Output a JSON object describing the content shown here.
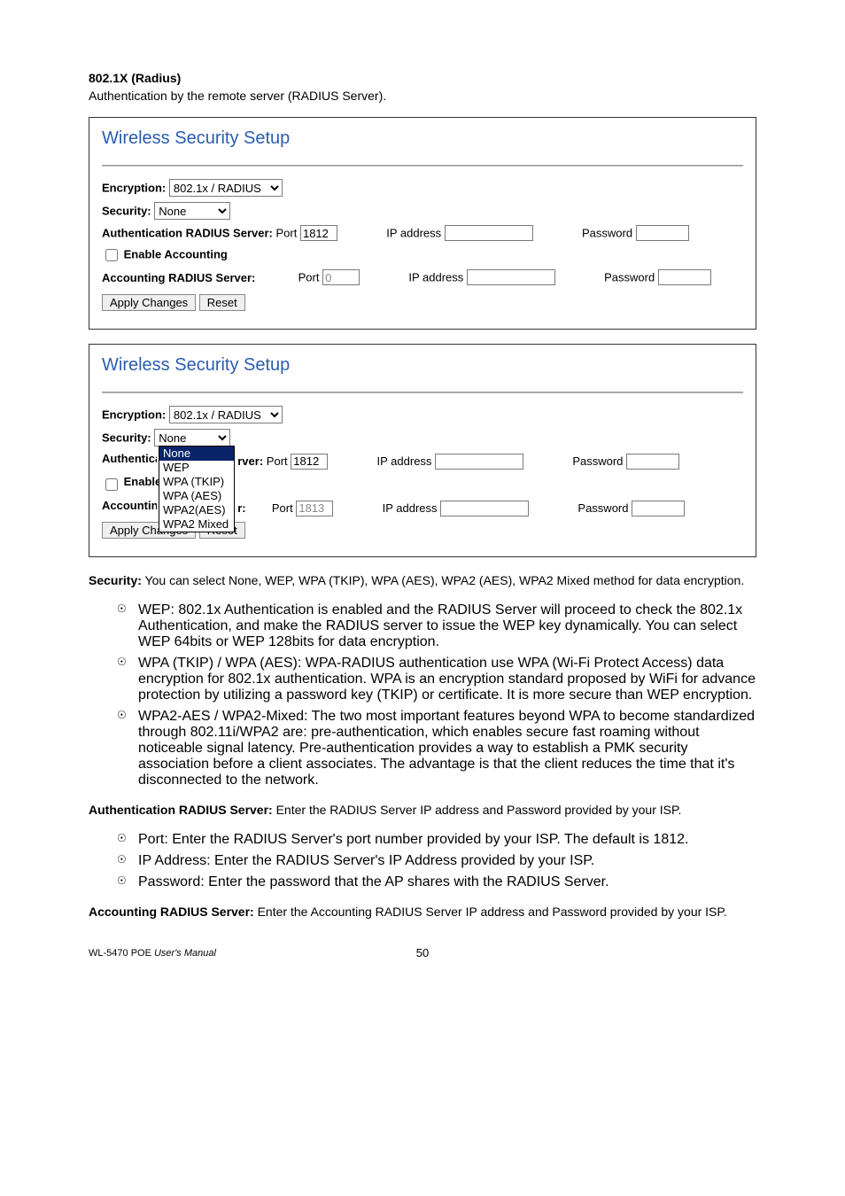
{
  "header": {
    "title": "802.1X (Radius)",
    "subtitle": "Authentication by the remote server (RADIUS Server)."
  },
  "panel1": {
    "title": "Wireless Security Setup",
    "encryption_label": "Encryption:",
    "encryption_value": "802.1x / RADIUS",
    "security_label": "Security:",
    "security_value": "None",
    "auth_label": "Authentication RADIUS Server:",
    "port_label": "Port",
    "auth_port_value": "1812",
    "ip_label": "IP address",
    "auth_ip_value": "",
    "pwd_label": "Password",
    "auth_pwd_value": "",
    "enable_acct_label": "Enable Accounting",
    "acct_label": "Accounting RADIUS Server:",
    "acct_port_value": "0",
    "acct_ip_value": "",
    "acct_pwd_value": "",
    "apply_btn": "Apply Changes",
    "reset_btn": "Reset"
  },
  "panel2": {
    "title": "Wireless Security Setup",
    "encryption_label": "Encryption:",
    "encryption_value": "802.1x / RADIUS",
    "security_label": "Security:",
    "security_value": "None",
    "auth_label_left": "Authentica",
    "auth_label_right": "rver:",
    "port_label": "Port",
    "auth_port_value": "1812",
    "ip_label": "IP address",
    "pwd_label": "Password",
    "enable_left": "Enable",
    "acct_left": "Accountin",
    "acct_right": "r:",
    "acct_port_value": "1813",
    "apply_btn": "Apply Changes",
    "reset_btn": "Reset",
    "dropdown_options": [
      "None",
      "WEP",
      "WPA (TKIP)",
      "WPA (AES)",
      "WPA2(AES)",
      "WPA2 Mixed"
    ],
    "dropdown_selected_index": 0
  },
  "desc": {
    "security_head": "Security:",
    "security_text": " You can select None, WEP, WPA (TKIP), WPA (AES), WPA2 (AES), WPA2 Mixed method for data encryption.",
    "wep_head": "WEP:",
    "wep_text": " 802.1x Authentication is enabled and the RADIUS Server will proceed to check the 802.1x Authentication, and make the RADIUS server to issue the WEP key dynamically. You can select WEP 64bits or WEP 128bits for data encryption.",
    "wpa_head": "WPA (TKIP) / WPA (AES):",
    "wpa_text": " WPA-RADIUS authentication use WPA (Wi-Fi Protect Access) data encryption for 802.1x authentication. WPA is an encryption standard proposed by WiFi for advance protection by utilizing a password key (TKIP) or certificate. It is more secure than WEP encryption.",
    "wpa2_head": "WPA2-AES / WPA2-Mixed:",
    "wpa2_text": " The two most important features beyond WPA to become standardized through 802.11i/WPA2 are: pre-authentication, which enables secure fast roaming without noticeable signal latency. Pre-authentication provides a way to establish a PMK security association before a client associates. The advantage is that the client reduces the time that it's disconnected to the network.",
    "authsrv_head": "Authentication RADIUS Server:",
    "authsrv_text": " Enter the RADIUS Server IP address and Password provided by your ISP.",
    "port_head": "Port:",
    "port_text": " Enter the RADIUS Server's port number provided by your ISP. The default is 1812.",
    "ip_head": "IP Address:",
    "ip_text": " Enter the RADIUS Server's IP Address provided by your ISP.",
    "pwd_head": "Password:",
    "pwd_text": " Enter the password that the AP shares with the RADIUS Server.",
    "acct_head": "Accounting RADIUS Server:",
    "acct_text": " Enter the Accounting RADIUS Server IP address and Password provided by your ISP."
  },
  "footer": {
    "left1": "WL-5470 POE ",
    "left2": "User's Manual",
    "page": "50"
  }
}
